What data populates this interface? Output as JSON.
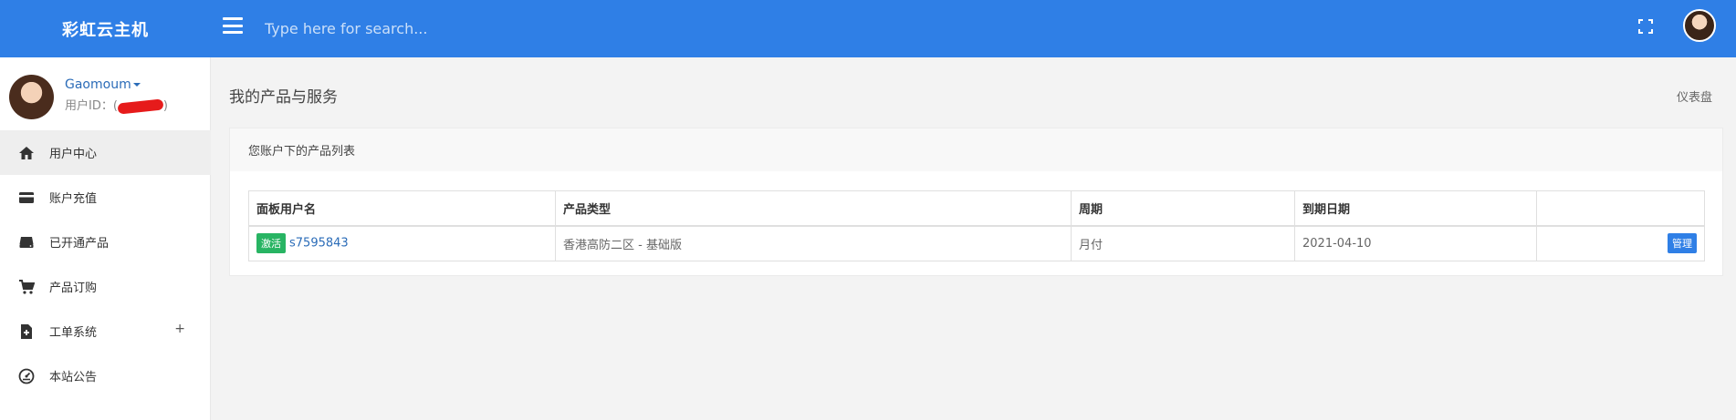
{
  "brand": {
    "name": "彩虹云主机"
  },
  "search": {
    "placeholder": "Type here for search..."
  },
  "user": {
    "name": "Gaomoum",
    "id_prefix": "用户ID：(",
    "id_suffix": ")"
  },
  "sidebar": {
    "items": [
      {
        "label": "用户中心",
        "icon": "home-icon",
        "active": true
      },
      {
        "label": "账户充值",
        "icon": "credit-card-icon"
      },
      {
        "label": "已开通产品",
        "icon": "server-icon"
      },
      {
        "label": "产品订购",
        "icon": "shopping-cart-icon"
      },
      {
        "label": "工单系统",
        "icon": "file-plus-icon",
        "expand": "+"
      },
      {
        "label": "本站公告",
        "icon": "dashboard-icon"
      }
    ]
  },
  "page": {
    "title": "我的产品与服务",
    "breadcrumb": "仪表盘"
  },
  "card": {
    "title": "您账户下的产品列表"
  },
  "table": {
    "headers": [
      "面板用户名",
      "产品类型",
      "周期",
      "到期日期",
      ""
    ],
    "rows": [
      {
        "status": "激活",
        "username": "s7595843",
        "type": "香港高防二区 - 基础版",
        "cycle": "月付",
        "expiry": "2021-04-10",
        "action": "管理"
      }
    ]
  },
  "colors": {
    "accent": "#2f7fe6",
    "active_badge": "#28b463"
  }
}
